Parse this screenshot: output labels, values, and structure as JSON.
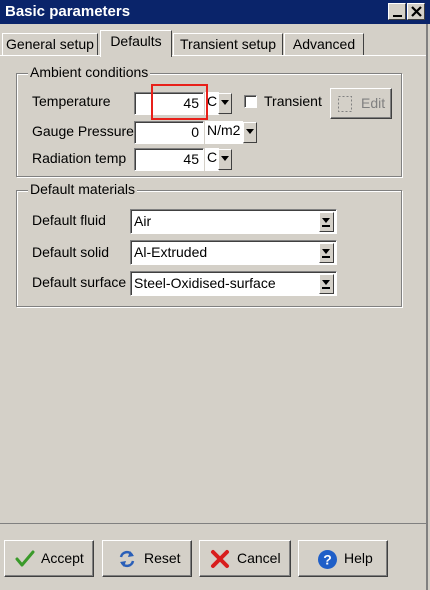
{
  "window": {
    "title": "Basic parameters"
  },
  "tabs": [
    {
      "label": "General setup"
    },
    {
      "label": "Defaults"
    },
    {
      "label": "Transient setup"
    },
    {
      "label": "Advanced"
    }
  ],
  "ambient": {
    "legend": "Ambient conditions",
    "temperature": {
      "label": "Temperature",
      "value": "45",
      "unit": "C"
    },
    "transient": {
      "label": "Transient",
      "checked": false
    },
    "edit_label": "Edit",
    "pressure": {
      "label": "Gauge Pressure",
      "value": "0",
      "unit": "N/m2"
    },
    "radiation": {
      "label": "Radiation temp",
      "value": "45",
      "unit": "C"
    }
  },
  "materials": {
    "legend": "Default materials",
    "fluid": {
      "label": "Default fluid",
      "value": "Air"
    },
    "solid": {
      "label": "Default solid",
      "value": "Al-Extruded"
    },
    "surface": {
      "label": "Default surface",
      "value": "Steel-Oxidised-surface"
    }
  },
  "buttons": {
    "accept": "Accept",
    "reset": "Reset",
    "cancel": "Cancel",
    "help": "Help"
  },
  "colors": {
    "titlebar": "#0a246a",
    "highlight": "#e8201a",
    "dialog_bg": "#d4d0c8"
  }
}
